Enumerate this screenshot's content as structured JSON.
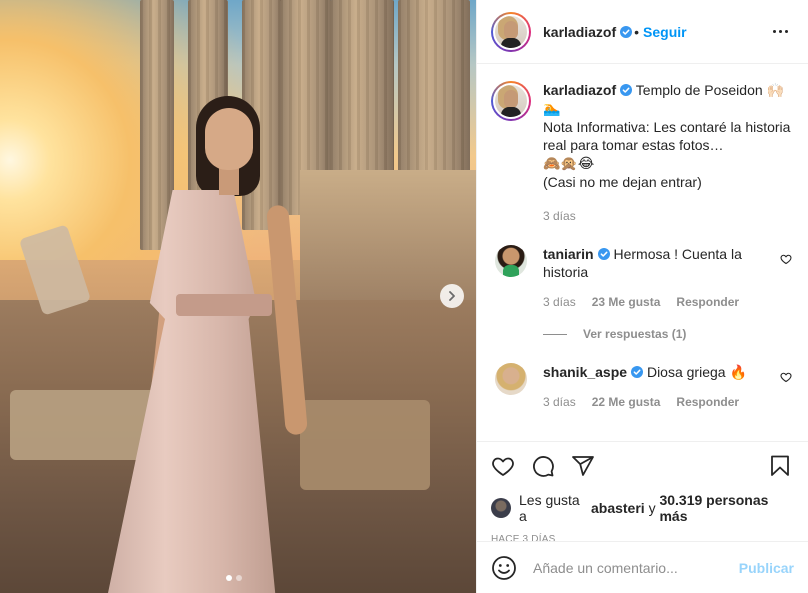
{
  "post": {
    "author": "karladiazof",
    "follow_label": "Seguir",
    "separator": "•",
    "photo_index": 1,
    "photo_count": 2
  },
  "caption": {
    "author": "karladiazof",
    "line1": "Templo de Poseidon 🙌🏻",
    "line1_emoji": "🏊",
    "line2": "Nota Informativa: Les contaré la historia real para tomar estas fotos…",
    "line2_emoji": "🙈🙊😂",
    "line3": "(Casi no me dejan entrar)",
    "time": "3 días"
  },
  "comments": [
    {
      "author": "taniarin",
      "text": "Hermosa ! Cuenta la historia",
      "time": "3 días",
      "likes": "23 Me gusta",
      "reply_label": "Responder",
      "view_replies": "Ver respuestas (1)"
    },
    {
      "author": "shanik_aspe",
      "text": "Diosa griega 🔥",
      "time": "3 días",
      "likes": "22 Me gusta",
      "reply_label": "Responder"
    }
  ],
  "likes_line": {
    "prefix": "Les gusta a",
    "user": "abasteri",
    "connector": "y",
    "count": "30.319 personas más"
  },
  "time_ago": "HACE 3 DÍAS",
  "composer": {
    "placeholder": "Añade un comentario...",
    "publish_label": "Publicar"
  },
  "colors": {
    "link_blue": "#0095f6",
    "muted_gray": "#8e8e8e",
    "text": "#262626"
  }
}
